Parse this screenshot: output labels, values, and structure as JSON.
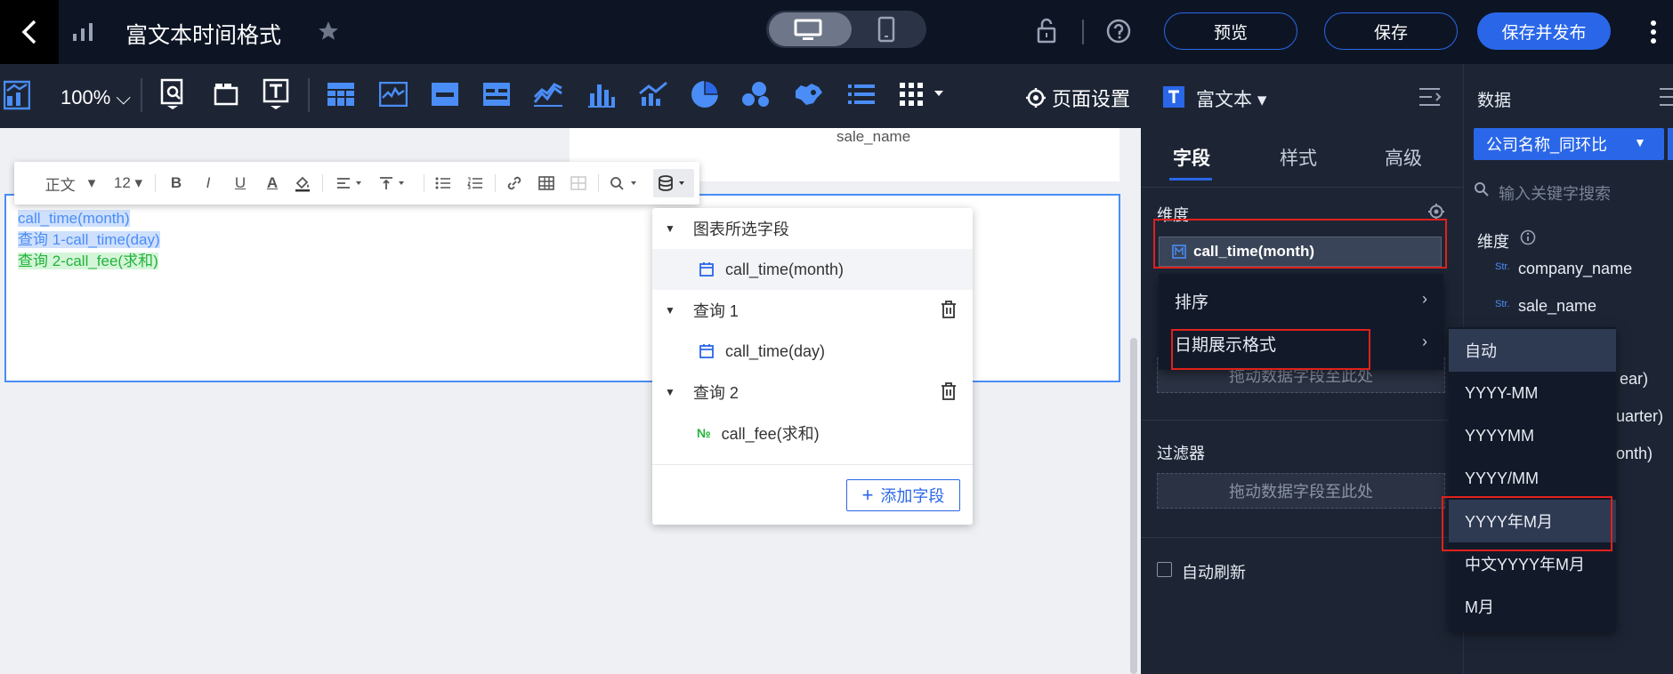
{
  "header": {
    "title": "富文本时间格式",
    "preview": "预览",
    "save": "保存",
    "save_publish": "保存并发布"
  },
  "toolbar": {
    "zoom": "100%",
    "page_settings": "页面设置"
  },
  "rich_text_toolbar": {
    "style": "正文",
    "size": "12"
  },
  "canvas": {
    "table_header": "sale_name",
    "lines": [
      "call_time(month)",
      "查询 1-call_time(day)",
      "查询 2-call_fee(求和)"
    ]
  },
  "field_dropdown": {
    "section_chart": "图表所选字段",
    "chart_field": "call_time(month)",
    "query1": "查询 1",
    "query1_field": "call_time(day)",
    "query2": "查询 2",
    "query2_field": "call_fee(求和)",
    "add_field": "添加字段"
  },
  "panel": {
    "component": "富文本",
    "tabs": [
      "字段",
      "样式",
      "高级"
    ],
    "dimension_label": "维度",
    "dimension_field": "call_time(month)",
    "drop_hint": "拖动数据字段至此处",
    "filter_label": "过滤器",
    "auto_refresh": "自动刷新"
  },
  "context_menu": {
    "items": [
      "排序",
      "日期展示格式"
    ]
  },
  "format_menu": {
    "items": [
      "自动",
      "YYYY-MM",
      "YYYYMM",
      "YYYY/MM",
      "YYYY年M月",
      "中文YYYY年M月",
      "M月"
    ]
  },
  "data_panel": {
    "title": "数据",
    "dataset": "公司名称_同环比",
    "search_placeholder": "输入关键字搜索",
    "dimension_label": "维度",
    "fields": [
      "company_name",
      "sale_name"
    ],
    "partial_fields": [
      "ear)",
      "uarter)",
      "onth)"
    ],
    "str_tag": "Str."
  },
  "colors": {
    "accent": "#2a67e8",
    "dark": "#1d2535",
    "highlight_red": "#e0211c"
  }
}
